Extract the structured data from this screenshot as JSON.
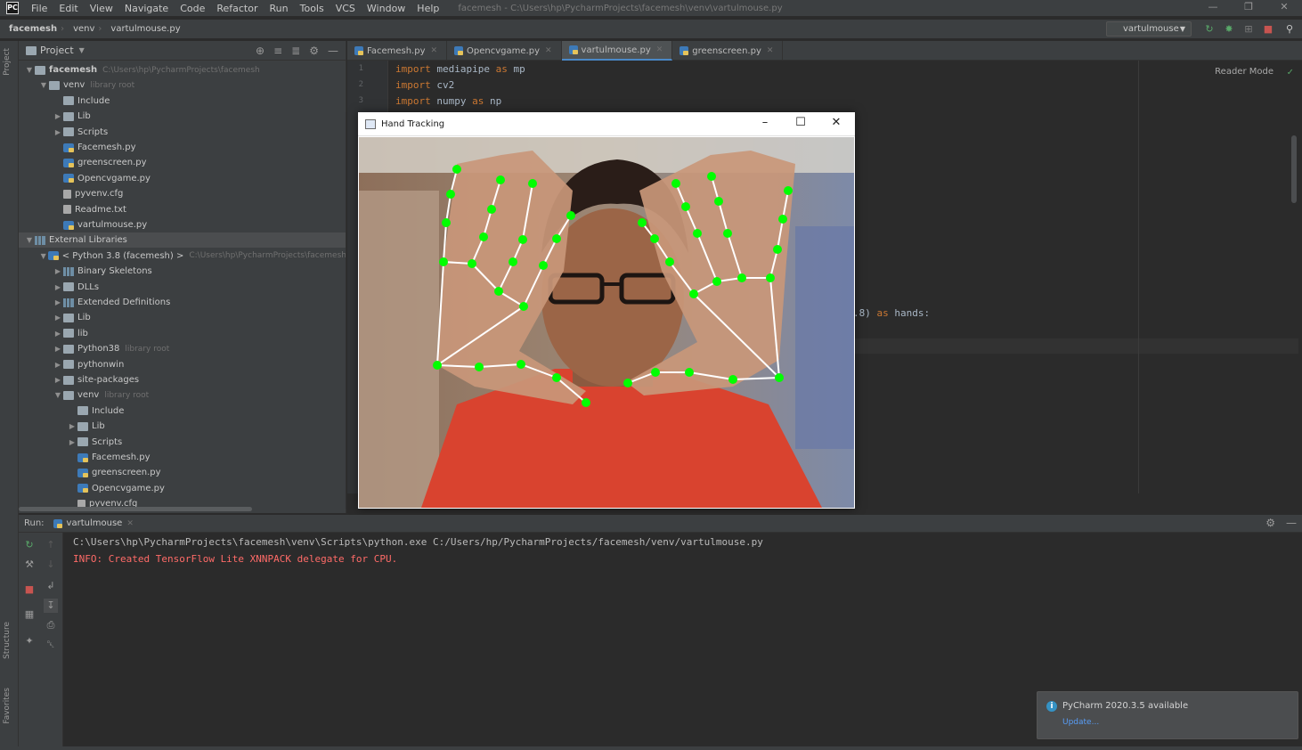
{
  "menubar": {
    "app_icon": "PC",
    "items": [
      "File",
      "Edit",
      "View",
      "Navigate",
      "Code",
      "Refactor",
      "Run",
      "Tools",
      "VCS",
      "Window",
      "Help"
    ],
    "window_title": "facemesh - C:\\Users\\hp\\PycharmProjects\\facemesh\\venv\\vartulmouse.py"
  },
  "navbar": {
    "crumbs": [
      "facemesh",
      "venv",
      "vartulmouse.py"
    ],
    "run_config": "vartulmouse"
  },
  "left_strip": {
    "project_tab": "Project",
    "structure_tab": "Structure",
    "favorites_tab": "Favorites"
  },
  "project": {
    "title": "Project",
    "rows": [
      {
        "label": "facemesh",
        "hint": "C:\\Users\\hp\\PycharmProjects\\facemesh"
      },
      {
        "label": "venv",
        "hint": "library root"
      },
      {
        "label": "Include"
      },
      {
        "label": "Lib"
      },
      {
        "label": "Scripts"
      },
      {
        "label": "Facemesh.py"
      },
      {
        "label": "greenscreen.py"
      },
      {
        "label": "Opencvgame.py"
      },
      {
        "label": "pyvenv.cfg"
      },
      {
        "label": "Readme.txt"
      },
      {
        "label": "vartulmouse.py"
      },
      {
        "label": "External Libraries"
      },
      {
        "label": "< Python 3.8 (facemesh) >",
        "hint": "C:\\Users\\hp\\PycharmProjects\\facemesh"
      },
      {
        "label": "Binary Skeletons"
      },
      {
        "label": "DLLs"
      },
      {
        "label": "Extended Definitions"
      },
      {
        "label": "Lib"
      },
      {
        "label": "lib"
      },
      {
        "label": "Python38",
        "hint": "library root"
      },
      {
        "label": "pythonwin"
      },
      {
        "label": "site-packages"
      },
      {
        "label": "venv",
        "hint": "library root"
      },
      {
        "label": "Include"
      },
      {
        "label": "Lib"
      },
      {
        "label": "Scripts"
      },
      {
        "label": "Facemesh.py"
      },
      {
        "label": "greenscreen.py"
      },
      {
        "label": "Opencvgame.py"
      },
      {
        "label": "pyvenv.cfg"
      }
    ]
  },
  "editor": {
    "tabs": [
      "Facemesh.py",
      "Opencvgame.py",
      "vartulmouse.py",
      "greenscreen.py"
    ],
    "active_tab": "vartulmouse.py",
    "reader_mode": "Reader Mode",
    "line_numbers": [
      "1",
      "2",
      "3"
    ],
    "code": {
      "line1_kw": "import",
      "line1_rest": " mediapipe ",
      "line1_as": "as",
      "line1_alias": " mp",
      "line2_kw": "import",
      "line2_rest": " cv2",
      "line3_kw": "import",
      "line3_rest": " numpy ",
      "line3_as": "as",
      "line3_alias": " np",
      "partial_rest": ".8) ",
      "partial_as": "as",
      "partial_alias": " hands:"
    }
  },
  "hand_tracking": {
    "title": "Hand Tracking",
    "landmark_color": "#00ff00",
    "connection_color": "#ffffff"
  },
  "run": {
    "label": "Run:",
    "tab": "vartulmouse",
    "console": [
      "C:\\Users\\hp\\PycharmProjects\\facemesh\\venv\\Scripts\\python.exe C:/Users/hp/PycharmProjects/facemesh/venv/vartulmouse.py",
      "INFO: Created TensorFlow Lite XNNPACK delegate for CPU."
    ],
    "console_colors": [
      "#bbbbbb",
      "#ff6b68"
    ]
  },
  "notification": {
    "title": "PyCharm 2020.3.5 available",
    "link": "Update..."
  },
  "colors": {
    "accent": "#4a88c7",
    "keyword": "#cc7832",
    "run_green": "#59a869",
    "stop_red": "#c75450"
  }
}
